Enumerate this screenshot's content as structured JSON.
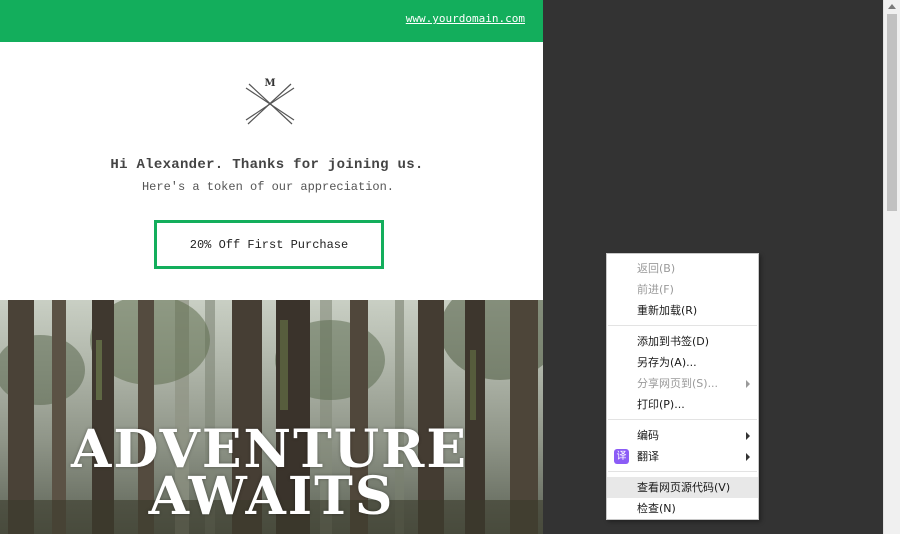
{
  "email": {
    "domain_link": "www.yourdomain.com",
    "logo_letter": "M",
    "greeting": "Hi Alexander. Thanks for joining us.",
    "subline": "Here's a token of our appreciation.",
    "offer_button": "20% Off First Purchase",
    "hero_line1": "ADVENTURE",
    "hero_line2": "AWAITS",
    "accent_color": "#13ae5c"
  },
  "context_menu": {
    "items": [
      {
        "label": "返回(B)",
        "disabled": true
      },
      {
        "label": "前进(F)",
        "disabled": true
      },
      {
        "label": "重新加载(R)",
        "disabled": false
      },
      {
        "label": "添加到书签(D)",
        "disabled": false
      },
      {
        "label": "另存为(A)...",
        "disabled": false
      },
      {
        "label": "分享网页到(S)...",
        "disabled": true,
        "submenu": true
      },
      {
        "label": "打印(P)...",
        "disabled": false
      },
      {
        "label": "编码",
        "disabled": false,
        "submenu": true
      },
      {
        "label": "翻译",
        "disabled": false,
        "submenu": true,
        "icon": "translate-icon",
        "icon_glyph": "译"
      },
      {
        "label": "查看网页源代码(V)",
        "disabled": false,
        "highlighted": true
      },
      {
        "label": "检查(N)",
        "disabled": false
      }
    ]
  }
}
